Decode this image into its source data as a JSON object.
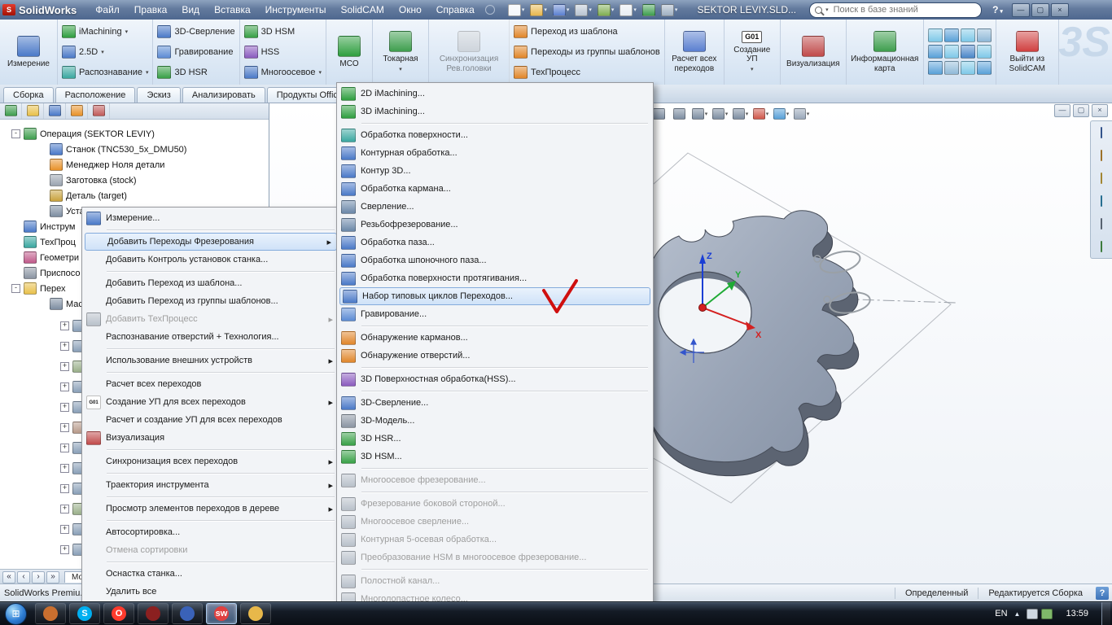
{
  "titlebar": {
    "app": "SolidWorks",
    "menus": [
      {
        "label": "Файл",
        "name": "menu-file"
      },
      {
        "label": "Правка",
        "name": "menu-edit"
      },
      {
        "label": "Вид",
        "name": "menu-view"
      },
      {
        "label": "Вставка",
        "name": "menu-insert"
      },
      {
        "label": "Инструменты",
        "name": "menu-tools"
      },
      {
        "label": "SolidCAM",
        "name": "menu-solidcam"
      },
      {
        "label": "Окно",
        "name": "menu-window"
      },
      {
        "label": "Справка",
        "name": "menu-help"
      }
    ],
    "doc_title": "SEKTOR LEVIY.SLD...",
    "search_placeholder": "Поиск в базе знаний",
    "help": "?",
    "win": {
      "min": "—",
      "max": "▢",
      "close": "×"
    }
  },
  "std_toolbar": [
    {
      "name": "new-document-icon",
      "ic": "#f4f7fb",
      "cls": "drop"
    },
    {
      "name": "open-icon",
      "ic": "#e7b74e",
      "cls": "drop"
    },
    {
      "name": "save-icon",
      "ic": "#5a7fd0",
      "cls": "drop"
    },
    {
      "name": "print-icon",
      "ic": "#b9c4d2",
      "cls": "drop"
    },
    {
      "name": "undo-icon",
      "ic": "#7fae52",
      "cls": "drop"
    },
    {
      "name": "select-arrow-icon",
      "ic": "#e8edf3",
      "cls": "drop"
    },
    {
      "name": "rebuild-icon",
      "ic": "#3e9e4e",
      "cls": ""
    },
    {
      "name": "options-icon",
      "ic": "#9fb0c2",
      "cls": "drop"
    }
  ],
  "ribbon": {
    "measure": "Измерение",
    "col1": [
      {
        "label": "iMachining",
        "ic": "#2e9e3f",
        "cls": "drop",
        "name": "imachining-button"
      },
      {
        "label": "2.5D",
        "ic": "#4a79c8",
        "cls": "drop",
        "name": "two-five-d-button"
      },
      {
        "label": "Распознавание",
        "ic": "#3aa7a0",
        "cls": "drop",
        "name": "recognition-button"
      }
    ],
    "col2": [
      {
        "label": "3D-Сверление",
        "ic": "#4a79c8",
        "name": "ribbon-3d-drilling-button"
      },
      {
        "label": "Гравирование",
        "ic": "#5b8bd4",
        "name": "ribbon-engraving-button"
      },
      {
        "label": "3D HSR",
        "ic": "#37a046",
        "name": "ribbon-3d-hsr-button"
      }
    ],
    "col3": [
      {
        "label": "3D HSM",
        "ic": "#37a046",
        "name": "ribbon-3d-hsm-button"
      },
      {
        "label": "HSS",
        "ic": "#8a5bbf",
        "name": "ribbon-hss-button"
      },
      {
        "label": "Многоосевое",
        "ic": "#4a79c8",
        "cls": "drop",
        "name": "ribbon-multiaxis-button"
      }
    ],
    "col4": [
      {
        "label": "Переход из шаблона",
        "ic": "#e0862a",
        "name": "op-from-template-button"
      },
      {
        "label": "Переходы из группы шаблонов",
        "ic": "#e0862a",
        "name": "ops-from-template-group-button"
      },
      {
        "label": "ТехПроцесс",
        "ic": "#e0862a",
        "name": "techprocess-button"
      }
    ],
    "mco": "MCO",
    "turning": "Токарная",
    "sync": "Синхронизация Рев.головки",
    "calc_all": "Расчет всех переходов",
    "g01_badge": "G01",
    "g01": "Создание УП",
    "visualization": "Визуализация",
    "info_card": "Информационная карта",
    "exit": "Выйти из SolidCAM",
    "sim_icons": [
      {
        "name": "sim-icon-1",
        "ic": "#7ec8e8"
      },
      {
        "name": "sim-icon-2",
        "ic": "#58a0d8"
      },
      {
        "name": "sim-icon-3",
        "ic": "#7ec8e8"
      },
      {
        "name": "sim-icon-4",
        "ic": "#8fb9d8"
      },
      {
        "name": "sim-icon-5",
        "ic": "#58a0d8"
      },
      {
        "name": "sim-icon-6",
        "ic": "#7ec8e8"
      },
      {
        "name": "sim-icon-7",
        "ic": "#4a86c8",
        "cls": ""
      },
      {
        "name": "sim-icon-8",
        "ic": "#7ec8e8"
      },
      {
        "name": "sim-icon-9",
        "ic": "#58a0d8"
      },
      {
        "name": "sim-icon-10",
        "ic": "#8fb9d8"
      },
      {
        "name": "sim-icon-11",
        "ic": "#7ec8e8"
      },
      {
        "name": "sim-icon-12",
        "ic": "#58a0d8"
      }
    ],
    "watermark": "3S"
  },
  "tabs": [
    {
      "label": "Сборка",
      "name": "tab-assembly"
    },
    {
      "label": "Расположение",
      "name": "tab-layout"
    },
    {
      "label": "Эскиз",
      "name": "tab-sketch"
    },
    {
      "label": "Анализировать",
      "name": "tab-evaluate"
    },
    {
      "label": "Продукты Offic",
      "name": "tab-office-products"
    }
  ],
  "panel_tabs": [
    {
      "name": "solidcam-manager-tab",
      "ic": "#3e9e4e"
    },
    {
      "name": "feature-manager-tab",
      "ic": "#e8c04a"
    },
    {
      "name": "property-manager-tab",
      "ic": "#4a79c8"
    },
    {
      "name": "configuration-manager-tab",
      "ic": "#e8922a"
    },
    {
      "name": "dimxpert-manager-tab",
      "ic": "#c05a5a"
    }
  ],
  "tree": {
    "rows": [
      {
        "label": "Операция (SEKTOR LEVIY)",
        "exp": "-",
        "cls": "hasexp",
        "ic": "#3e9e4e",
        "name": "tree-operation"
      },
      {
        "label": "Станок (TNC530_5x_DMU50)",
        "cls": "ind2",
        "ic": "#4a79c8",
        "name": "tree-machine"
      },
      {
        "label": "Менеджер Ноля детали",
        "cls": "ind2",
        "ic": "#e8922a",
        "name": "tree-zero-manager"
      },
      {
        "label": "Заготовка (stock)",
        "cls": "ind2",
        "ic": "#9aa4b0",
        "name": "tree-stock"
      },
      {
        "label": "Деталь (target)",
        "cls": "ind2",
        "ic": "#c8a23c",
        "name": "tree-target"
      },
      {
        "label": "Уста",
        "cls": "ind2",
        "ic": "#7d8da1",
        "name": "tree-setup"
      },
      {
        "label": "Инструм",
        "ic": "#4a79c8",
        "name": "tree-tools"
      },
      {
        "label": "ТехПроц",
        "ic": "#3aa7a0",
        "name": "tree-techprocess"
      },
      {
        "label": "Геометри",
        "ic": "#c05a8a",
        "name": "tree-geometry"
      },
      {
        "label": "Приспосо",
        "ic": "#8a94a2",
        "name": "tree-fixtures"
      },
      {
        "label": "Перех",
        "exp": "-",
        "cls": "hasexp",
        "ic": "#e8c04a",
        "name": "tree-operations-folder"
      },
      {
        "label": "Мас",
        "cls": "ind2",
        "ic": "#7d8da1",
        "name": "tree-mas"
      }
    ],
    "stubs": [
      {
        "exp": "+",
        "ic": "#8aa0b8"
      },
      {
        "exp": "+",
        "ic": "#8aa0b8"
      },
      {
        "exp": "+",
        "ic": "#9ab08a"
      },
      {
        "exp": "+",
        "ic": "#8aa0b8"
      },
      {
        "exp": "+",
        "ic": "#8aa0b8"
      },
      {
        "exp": "+",
        "ic": "#b89a8a"
      },
      {
        "exp": "+",
        "ic": "#8aa0b8"
      },
      {
        "exp": "+",
        "ic": "#8aa0b8"
      },
      {
        "exp": "+",
        "ic": "#8aa0b8"
      },
      {
        "exp": "+",
        "ic": "#9ab08a"
      },
      {
        "exp": "+",
        "ic": "#8aa0b8"
      },
      {
        "exp": "+",
        "ic": "#8aa0b8"
      }
    ],
    "nav_arrows": [
      "«",
      "‹",
      "›",
      "»"
    ],
    "nav_tab": "Мо..."
  },
  "context_menu": {
    "items": [
      {
        "label": "Измерение...",
        "cls": "has-icon",
        "ic": "#4a79c8",
        "name": "ctx-measure"
      },
      {
        "cls": "msep"
      },
      {
        "label": "Добавить Переходы Фрезерования",
        "cls": "hl arrow",
        "name": "ctx-add-milling-operations"
      },
      {
        "label": "Добавить Контроль установок станка...",
        "name": "ctx-add-machine-control"
      },
      {
        "cls": "msep"
      },
      {
        "label": "Добавить Переход из шаблона...",
        "name": "ctx-add-op-from-template"
      },
      {
        "label": "Добавить Переход из группы шаблонов...",
        "name": "ctx-add-op-from-template-group"
      },
      {
        "label": "Добавить ТехПроцесс",
        "cls": "disabled arrow has-icon",
        "ic": "#b8c0ca",
        "name": "ctx-add-techprocess"
      },
      {
        "label": "Распознавание отверстий + Технология...",
        "name": "ctx-hole-recognition"
      },
      {
        "cls": "msep"
      },
      {
        "label": "Использование внешних устройств",
        "cls": "arrow",
        "name": "ctx-external-devices"
      },
      {
        "cls": "msep"
      },
      {
        "label": "Расчет всех переходов",
        "name": "ctx-calculate-all"
      },
      {
        "label": "Создание УП для всех переходов",
        "cls": "arrow has-icon",
        "ic": "#ffffff",
        "icon_text": "G01",
        "name": "ctx-generate-nc-all"
      },
      {
        "label": "Расчет и создание УП для всех переходов",
        "name": "ctx-calc-and-generate-all"
      },
      {
        "label": "Визуализация",
        "cls": "has-icon",
        "ic": "#c04a4a",
        "name": "ctx-simulation"
      },
      {
        "cls": "msep"
      },
      {
        "label": "Синхронизация всех переходов",
        "cls": "arrow",
        "name": "ctx-sync-all"
      },
      {
        "cls": "msep"
      },
      {
        "label": "Траектория инструмента",
        "cls": "arrow",
        "name": "ctx-toolpath"
      },
      {
        "cls": "msep"
      },
      {
        "label": "Просмотр элементов переходов в дереве",
        "cls": "arrow",
        "name": "ctx-show-op-elements"
      },
      {
        "cls": "msep"
      },
      {
        "label": "Автосортировка...",
        "name": "ctx-autosort"
      },
      {
        "label": "Отмена сортировки",
        "cls": "disabled",
        "name": "ctx-undo-sort"
      },
      {
        "cls": "msep"
      },
      {
        "label": "Оснастка станка...",
        "name": "ctx-machine-tooling"
      },
      {
        "label": "Удалить все",
        "name": "ctx-delete-all"
      }
    ]
  },
  "submenu": {
    "items": [
      {
        "label": "2D iMachining...",
        "cls": "has-icon",
        "ic": "#2e9e3f",
        "name": "sub-2d-imachining"
      },
      {
        "label": "3D iMachining...",
        "cls": "has-icon",
        "ic": "#2e9e3f",
        "name": "sub-3d-imachining"
      },
      {
        "cls": "msep"
      },
      {
        "label": "Обработка поверхности...",
        "cls": "has-icon",
        "ic": "#3aa7a0",
        "name": "sub-face-milling"
      },
      {
        "label": "Контурная обработка...",
        "cls": "has-icon",
        "ic": "#4a79c8",
        "name": "sub-profile-milling"
      },
      {
        "label": "Контур 3D...",
        "cls": "has-icon",
        "ic": "#4a79c8",
        "name": "sub-contour-3d"
      },
      {
        "label": "Обработка кармана...",
        "cls": "has-icon",
        "ic": "#4a79c8",
        "name": "sub-pocket-milling"
      },
      {
        "label": "Сверление...",
        "cls": "has-icon",
        "ic": "#6a87a8",
        "name": "sub-drilling"
      },
      {
        "label": "Резьбофрезерование...",
        "cls": "has-icon",
        "ic": "#6a87a8",
        "name": "sub-thread-milling"
      },
      {
        "label": "Обработка паза...",
        "cls": "has-icon",
        "ic": "#4a79c8",
        "name": "sub-slot-milling"
      },
      {
        "label": "Обработка шпоночного паза...",
        "cls": "has-icon",
        "ic": "#4a79c8",
        "name": "sub-keyway-milling"
      },
      {
        "label": "Обработка поверхности протягивания...",
        "cls": "has-icon",
        "ic": "#4a79c8",
        "name": "sub-broaching"
      },
      {
        "label": "Набор типовых циклов Переходов...",
        "cls": "has-icon hl",
        "ic": "#4a79c8",
        "name": "sub-typical-cycles"
      },
      {
        "label": "Гравирование...",
        "cls": "has-icon",
        "ic": "#5b8bd4",
        "name": "sub-engraving"
      },
      {
        "cls": "msep"
      },
      {
        "label": "Обнаружение карманов...",
        "cls": "has-icon",
        "ic": "#e0862a",
        "name": "sub-pocket-recognition"
      },
      {
        "label": "Обнаружение отверстий...",
        "cls": "has-icon",
        "ic": "#e0862a",
        "name": "sub-hole-recognition"
      },
      {
        "cls": "msep"
      },
      {
        "label": "3D Поверхностная обработка(HSS)...",
        "cls": "has-icon",
        "ic": "#8a5bbf",
        "name": "sub-hss"
      },
      {
        "cls": "msep"
      },
      {
        "label": "3D-Сверление...",
        "cls": "has-icon",
        "ic": "#4a79c8",
        "name": "sub-3d-drilling"
      },
      {
        "label": "3D-Модель...",
        "cls": "has-icon",
        "ic": "#8a94a2",
        "name": "sub-3d-model"
      },
      {
        "label": "3D HSR...",
        "cls": "has-icon",
        "ic": "#37a046",
        "name": "sub-3d-hsr"
      },
      {
        "label": "3D HSM...",
        "cls": "has-icon",
        "ic": "#37a046",
        "name": "sub-3d-hsm"
      },
      {
        "cls": "msep"
      },
      {
        "label": "Многоосевое фрезерование...",
        "cls": "disabled has-icon",
        "ic": "#b8c0ca",
        "name": "sub-multiaxis-milling"
      },
      {
        "cls": "msep"
      },
      {
        "label": "Фрезерование боковой стороной...",
        "cls": "disabled has-icon",
        "ic": "#b8c0ca",
        "name": "sub-swarf-milling"
      },
      {
        "label": "Многоосевое сверление...",
        "cls": "disabled has-icon",
        "ic": "#b8c0ca",
        "name": "sub-multiaxis-drilling"
      },
      {
        "label": "Контурная 5-осевая обработка...",
        "cls": "disabled has-icon",
        "ic": "#b8c0ca",
        "name": "sub-5axis-contour"
      },
      {
        "label": "Преобразование HSM в многоосевое фрезерование...",
        "cls": "disabled has-icon",
        "ic": "#b8c0ca",
        "name": "sub-hsm-to-multiaxis"
      },
      {
        "cls": "msep"
      },
      {
        "label": "Полостной канал...",
        "cls": "disabled has-icon",
        "ic": "#b8c0ca",
        "name": "sub-port-machining"
      },
      {
        "label": "Многолопастное колесо...",
        "cls": "disabled has-icon",
        "ic": "#b8c0ca",
        "name": "sub-impeller"
      }
    ]
  },
  "hud": [
    {
      "name": "zoom-fit-icon",
      "ic": "#7d8da1"
    },
    {
      "name": "zoom-area-icon",
      "ic": "#7d8da1"
    },
    {
      "name": "view-orientation-icon",
      "ic": "#7d8da1",
      "cls": "drop"
    },
    {
      "name": "display-style-icon",
      "ic": "#7d8da1",
      "cls": "drop"
    },
    {
      "name": "hide-show-icon",
      "ic": "#7d8da1",
      "cls": "drop"
    },
    {
      "name": "appearances-icon",
      "ic": "#d0574a",
      "cls": "drop"
    },
    {
      "name": "scene-icon",
      "ic": "#58a0d8",
      "cls": "drop"
    },
    {
      "name": "view-settings-icon",
      "ic": "#9aa8ba",
      "cls": "drop"
    }
  ],
  "taskpane": [
    {
      "name": "resources-icon",
      "ic": "#4a79c8"
    },
    {
      "name": "design-library-icon",
      "ic": "#e0a23c"
    },
    {
      "name": "file-explorer-icon",
      "ic": "#e8c04a"
    },
    {
      "name": "appearances-icon",
      "ic": "#3aa0d0"
    },
    {
      "name": "custom-properties-icon",
      "ic": "#7d8da1"
    },
    {
      "name": "document-recovery-icon",
      "ic": "#58b058"
    }
  ],
  "viewport": {
    "axis": {
      "x": "X",
      "y": "Y",
      "z": "Z"
    }
  },
  "statusbar": {
    "left": "SolidWorks Premiu...",
    "status1": "Определенный",
    "status2": "Редактируется Сборка",
    "help": "?"
  },
  "taskbar": {
    "apps": [
      {
        "name": "taskbar-app-1",
        "glyph": "",
        "ic": "#c96f2f"
      },
      {
        "name": "taskbar-skype",
        "glyph": "S",
        "ic": "#00aff0"
      },
      {
        "name": "taskbar-opera",
        "glyph": "O",
        "ic": "#ff3b2d"
      },
      {
        "name": "taskbar-app-2",
        "glyph": "",
        "ic": "#8b2020"
      },
      {
        "name": "taskbar-app-3",
        "glyph": "",
        "ic": "#3a62b8"
      },
      {
        "name": "taskbar-solidworks",
        "glyph": "sw",
        "ic": "#e04040",
        "cls": "active"
      },
      {
        "name": "taskbar-app-4",
        "glyph": "",
        "ic": "#e8b84a"
      }
    ],
    "tray_icons": [
      {
        "name": "tray-icon-1",
        "ic": "#cfd8e2"
      },
      {
        "name": "tray-icon-2",
        "ic": "#7fb96a"
      }
    ],
    "lang": "EN",
    "time": "13:59"
  }
}
